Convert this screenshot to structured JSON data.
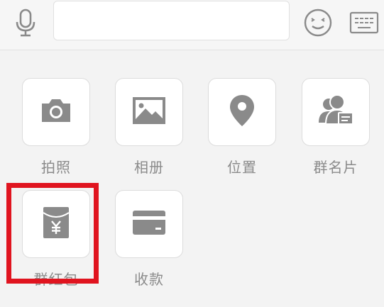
{
  "input_bar": {
    "text_value": "",
    "icons": {
      "voice": "microphone-icon",
      "emoji": "smiley-face-icon",
      "keyboard": "keyboard-icon"
    }
  },
  "panel": {
    "items": [
      {
        "label": "拍照",
        "icon": "camera-icon"
      },
      {
        "label": "相册",
        "icon": "photo-album-icon"
      },
      {
        "label": "位置",
        "icon": "location-pin-icon"
      },
      {
        "label": "群名片",
        "icon": "group-card-icon"
      },
      {
        "label": "群红包",
        "icon": "red-envelope-icon"
      },
      {
        "label": "收款",
        "icon": "payment-card-icon"
      }
    ]
  },
  "colors": {
    "icon_gray": "#8a8a8a",
    "highlight_red": "#e0141f",
    "background": "#f3f3f3",
    "tile_background": "#ffffff"
  }
}
